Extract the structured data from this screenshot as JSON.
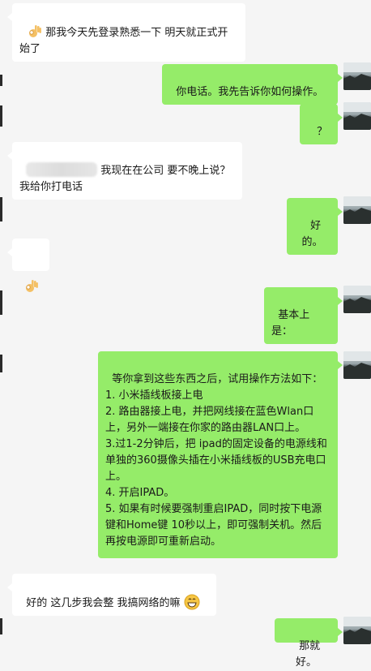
{
  "messages": [
    {
      "side": "left",
      "text": "那我今天先登录熟悉一下 明天就正式开始了",
      "icon": "ok-hand-emoji"
    },
    {
      "side": "right",
      "text": "你电话。我先告诉你如何操作。"
    },
    {
      "side": "right",
      "text": "？"
    },
    {
      "side": "left",
      "text": "我现在在公司 要不晚上说？\n我给你打电话"
    },
    {
      "side": "right",
      "text": "好的。"
    },
    {
      "side": "left",
      "text": "",
      "icon": "ok-hand-emoji"
    },
    {
      "side": "right",
      "text": "基本上是："
    },
    {
      "side": "right",
      "text": "等你拿到这些东西之后，试用操作方法如下：\n1. 小米插线板接上电\n2. 路由器接上电，并把网线接在蓝色Wlan口上，另外一端接在你家的路由器LAN口上。\n3.过1-2分钟后，把 ipad的固定设备的电源线和单独的360摄像头插在小米插线板的USB充电口上。\n4. 开启IPAD。\n5. 如果有时候要强制重启IPAD，同时按下电源键和Home键 10秒以上，即可强制关机。然后再按电源即可重新启动。"
    },
    {
      "side": "left",
      "text": "好的 这几步我会整 我搞网络的嘛",
      "icon": "grin-emoji"
    },
    {
      "side": "right",
      "text": "那就好。"
    }
  ],
  "colors": {
    "sent": "#95ec69",
    "received": "#ffffff",
    "background": "#f5f5f5"
  }
}
